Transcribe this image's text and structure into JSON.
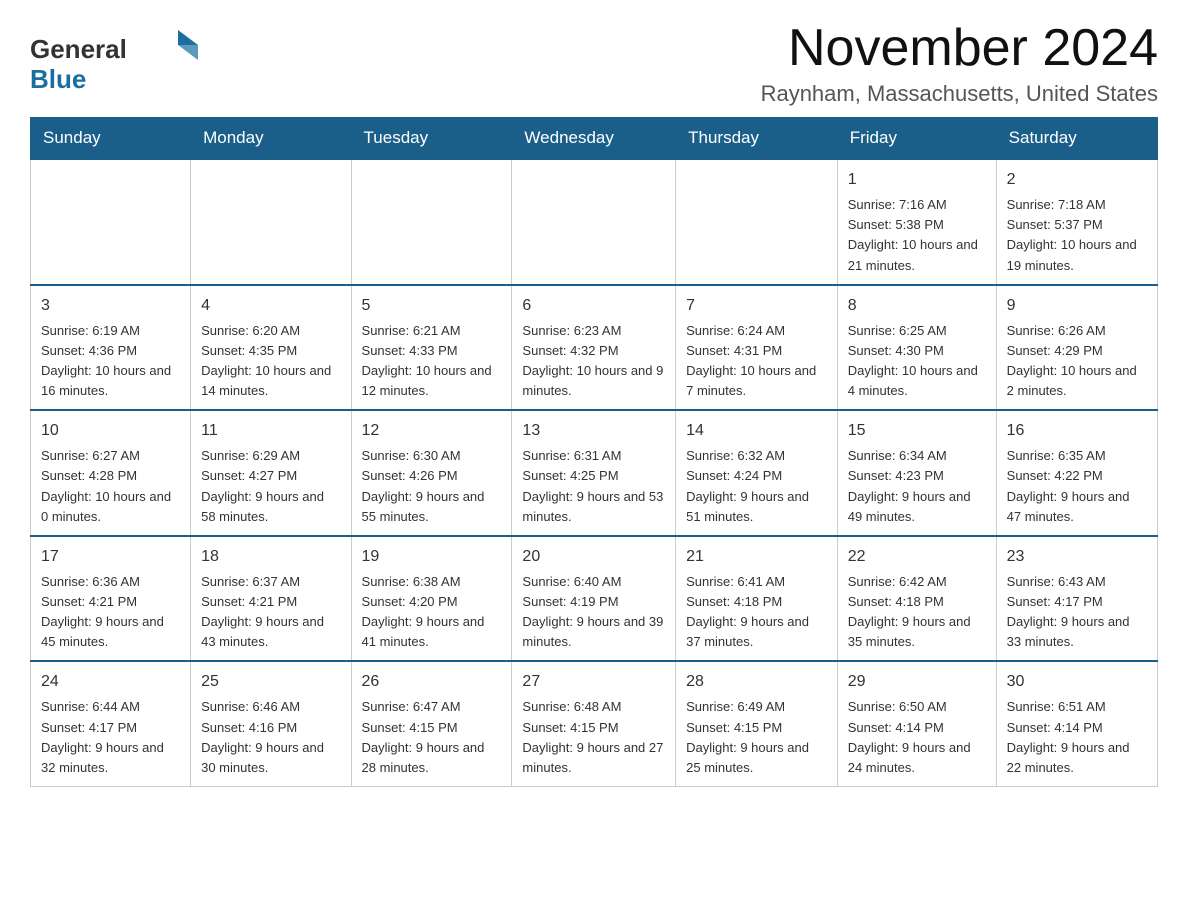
{
  "header": {
    "logo_general": "General",
    "logo_blue": "Blue",
    "title": "November 2024",
    "subtitle": "Raynham, Massachusetts, United States"
  },
  "days_of_week": [
    "Sunday",
    "Monday",
    "Tuesday",
    "Wednesday",
    "Thursday",
    "Friday",
    "Saturday"
  ],
  "weeks": [
    [
      {
        "day": "",
        "info": ""
      },
      {
        "day": "",
        "info": ""
      },
      {
        "day": "",
        "info": ""
      },
      {
        "day": "",
        "info": ""
      },
      {
        "day": "",
        "info": ""
      },
      {
        "day": "1",
        "info": "Sunrise: 7:16 AM\nSunset: 5:38 PM\nDaylight: 10 hours\nand 21 minutes."
      },
      {
        "day": "2",
        "info": "Sunrise: 7:18 AM\nSunset: 5:37 PM\nDaylight: 10 hours\nand 19 minutes."
      }
    ],
    [
      {
        "day": "3",
        "info": "Sunrise: 6:19 AM\nSunset: 4:36 PM\nDaylight: 10 hours\nand 16 minutes."
      },
      {
        "day": "4",
        "info": "Sunrise: 6:20 AM\nSunset: 4:35 PM\nDaylight: 10 hours\nand 14 minutes."
      },
      {
        "day": "5",
        "info": "Sunrise: 6:21 AM\nSunset: 4:33 PM\nDaylight: 10 hours\nand 12 minutes."
      },
      {
        "day": "6",
        "info": "Sunrise: 6:23 AM\nSunset: 4:32 PM\nDaylight: 10 hours\nand 9 minutes."
      },
      {
        "day": "7",
        "info": "Sunrise: 6:24 AM\nSunset: 4:31 PM\nDaylight: 10 hours\nand 7 minutes."
      },
      {
        "day": "8",
        "info": "Sunrise: 6:25 AM\nSunset: 4:30 PM\nDaylight: 10 hours\nand 4 minutes."
      },
      {
        "day": "9",
        "info": "Sunrise: 6:26 AM\nSunset: 4:29 PM\nDaylight: 10 hours\nand 2 minutes."
      }
    ],
    [
      {
        "day": "10",
        "info": "Sunrise: 6:27 AM\nSunset: 4:28 PM\nDaylight: 10 hours\nand 0 minutes."
      },
      {
        "day": "11",
        "info": "Sunrise: 6:29 AM\nSunset: 4:27 PM\nDaylight: 9 hours\nand 58 minutes."
      },
      {
        "day": "12",
        "info": "Sunrise: 6:30 AM\nSunset: 4:26 PM\nDaylight: 9 hours\nand 55 minutes."
      },
      {
        "day": "13",
        "info": "Sunrise: 6:31 AM\nSunset: 4:25 PM\nDaylight: 9 hours\nand 53 minutes."
      },
      {
        "day": "14",
        "info": "Sunrise: 6:32 AM\nSunset: 4:24 PM\nDaylight: 9 hours\nand 51 minutes."
      },
      {
        "day": "15",
        "info": "Sunrise: 6:34 AM\nSunset: 4:23 PM\nDaylight: 9 hours\nand 49 minutes."
      },
      {
        "day": "16",
        "info": "Sunrise: 6:35 AM\nSunset: 4:22 PM\nDaylight: 9 hours\nand 47 minutes."
      }
    ],
    [
      {
        "day": "17",
        "info": "Sunrise: 6:36 AM\nSunset: 4:21 PM\nDaylight: 9 hours\nand 45 minutes."
      },
      {
        "day": "18",
        "info": "Sunrise: 6:37 AM\nSunset: 4:21 PM\nDaylight: 9 hours\nand 43 minutes."
      },
      {
        "day": "19",
        "info": "Sunrise: 6:38 AM\nSunset: 4:20 PM\nDaylight: 9 hours\nand 41 minutes."
      },
      {
        "day": "20",
        "info": "Sunrise: 6:40 AM\nSunset: 4:19 PM\nDaylight: 9 hours\nand 39 minutes."
      },
      {
        "day": "21",
        "info": "Sunrise: 6:41 AM\nSunset: 4:18 PM\nDaylight: 9 hours\nand 37 minutes."
      },
      {
        "day": "22",
        "info": "Sunrise: 6:42 AM\nSunset: 4:18 PM\nDaylight: 9 hours\nand 35 minutes."
      },
      {
        "day": "23",
        "info": "Sunrise: 6:43 AM\nSunset: 4:17 PM\nDaylight: 9 hours\nand 33 minutes."
      }
    ],
    [
      {
        "day": "24",
        "info": "Sunrise: 6:44 AM\nSunset: 4:17 PM\nDaylight: 9 hours\nand 32 minutes."
      },
      {
        "day": "25",
        "info": "Sunrise: 6:46 AM\nSunset: 4:16 PM\nDaylight: 9 hours\nand 30 minutes."
      },
      {
        "day": "26",
        "info": "Sunrise: 6:47 AM\nSunset: 4:15 PM\nDaylight: 9 hours\nand 28 minutes."
      },
      {
        "day": "27",
        "info": "Sunrise: 6:48 AM\nSunset: 4:15 PM\nDaylight: 9 hours\nand 27 minutes."
      },
      {
        "day": "28",
        "info": "Sunrise: 6:49 AM\nSunset: 4:15 PM\nDaylight: 9 hours\nand 25 minutes."
      },
      {
        "day": "29",
        "info": "Sunrise: 6:50 AM\nSunset: 4:14 PM\nDaylight: 9 hours\nand 24 minutes."
      },
      {
        "day": "30",
        "info": "Sunrise: 6:51 AM\nSunset: 4:14 PM\nDaylight: 9 hours\nand 22 minutes."
      }
    ]
  ]
}
